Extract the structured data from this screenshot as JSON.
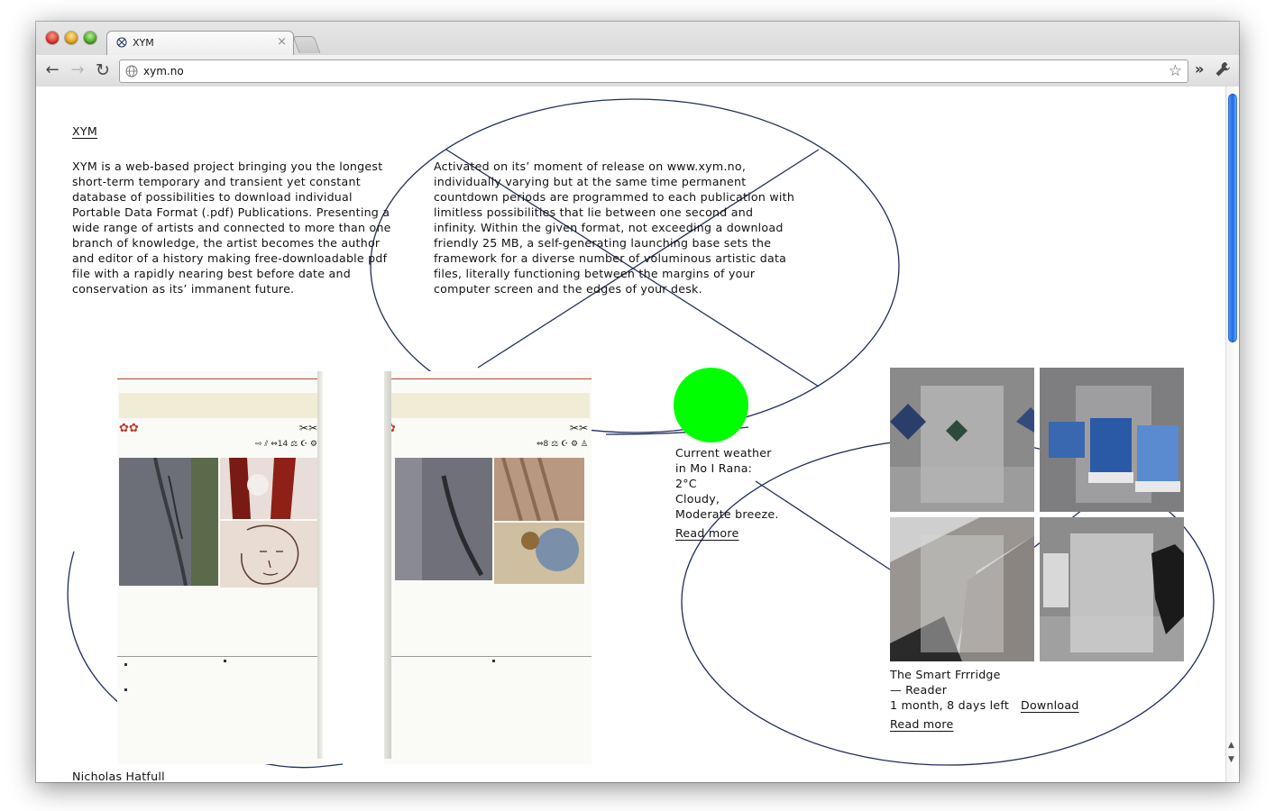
{
  "browser": {
    "tab_title": "XYM",
    "tab_close": "×",
    "url": "xym.no",
    "nav": {
      "back": "←",
      "forward": "→",
      "reload": "↻"
    },
    "star": "☆",
    "overflow": "»",
    "icons": [
      "xym-favicon",
      "globe-icon",
      "star-icon",
      "wrench-icon",
      "chevron-icon"
    ]
  },
  "page": {
    "site_title": "XYM",
    "intro_left": "XYM is a web-based project bringing you the longest\nshort-term temporary and transient yet constant\ndatabase of possibilities to download individual\nPortable Data Format (.pdf) Publications. Presenting a\nwide range of artists and connected to more than one\nbranch of knowledge, the artist becomes the author\nand editor of a history making free-downloadable pdf\nfile with a rapidly nearing best before date and\nconservation as its’ immanent future.",
    "intro_right": "Activated on its’ moment of release on www.xym.no,\nindividually varying but at the same time permanent\ncountdown periods are programmed to each publication with\nlimitless possibilities that lie between one second and\ninfinity. Within the given format, not exceeding a download\nfriendly 25 MB, a self-generating launching base sets the\nframework for a diverse number of voluminous artistic data\nfiles, literally functioning between the margins of your\ncomputer screen and the edges of your desk.",
    "book": {
      "left_flowers": "✿✿",
      "left_tools": "✂✂",
      "left_icons": "⇨ ⫽ ⇔14 ⚖ ☪ ⚙",
      "right_flowers": "✿",
      "right_tools": "✂✂",
      "right_icons": "⇔8 ⚖ ☪ ⚙ ♙"
    },
    "weather": {
      "text": "Current weather\nin Mo I Rana:\n2°C\nCloudy,\nModerate breeze.",
      "read_more": "Read more",
      "indicator_color": "#00ff00"
    },
    "publication": {
      "title": "The Smart Frrridge\n— Reader",
      "time_left": "1 month, 8 days left",
      "download": "Download",
      "read_more": "Read more"
    },
    "author": "Nicholas Hatfull"
  },
  "colors": {
    "ellipse_stroke": "#1f2f5c",
    "scroll_thumb": "#1a6be8"
  }
}
